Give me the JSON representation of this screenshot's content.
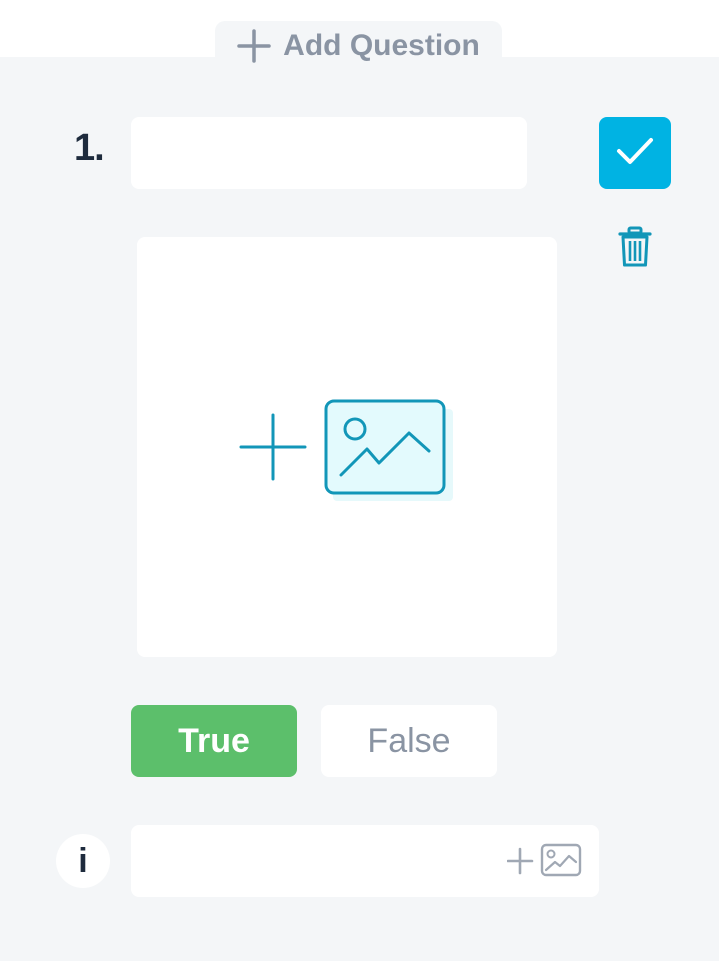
{
  "header": {
    "add_question_label": "Add Question",
    "add_question_icon": "plus-icon"
  },
  "question": {
    "number": "1.",
    "text_value": "",
    "text_placeholder": "",
    "confirm_icon": "check-icon",
    "delete_icon": "trash-icon",
    "image_upload_icon": "add-image-icon"
  },
  "answers": {
    "true_label": "True",
    "false_label": "False",
    "selected": "True"
  },
  "explanation": {
    "info_glyph": "i",
    "value": "",
    "placeholder": "",
    "add_image_icon": "add-image-icon"
  },
  "colors": {
    "accent_blue": "#00b3e3",
    "true_green": "#5cbf6b",
    "icon_teal": "#1296b8",
    "muted_gray": "#8a94a3",
    "dark_text": "#1e2b3d",
    "background": "#f4f6f8"
  }
}
